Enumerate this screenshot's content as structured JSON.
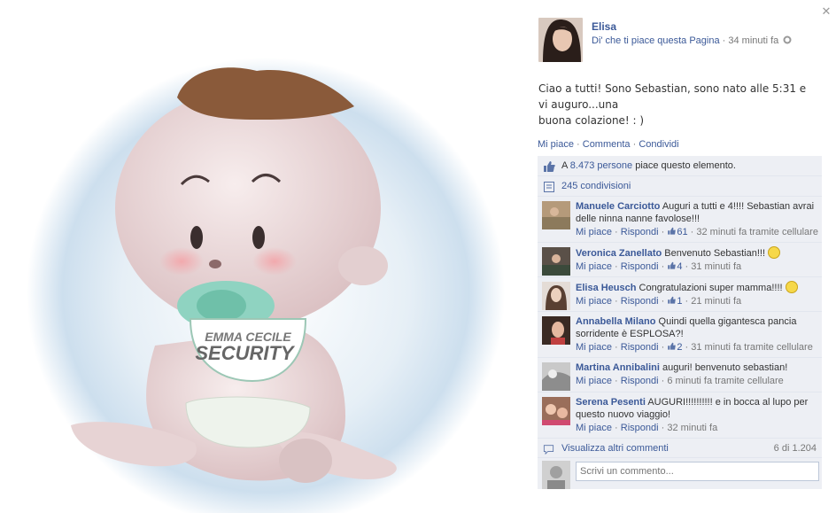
{
  "photo": {
    "bib_line1": "EMMA CECILE",
    "bib_line2": "SECURITY"
  },
  "post": {
    "close_glyph": "✕",
    "author_name": "Elisa",
    "like_page_link": "Di' che ti piace questa Pagina",
    "separator": " · ",
    "time": "34 minuti fa",
    "globe_icon": "globe-icon",
    "text_line1": "Ciao a tutti! Sono Sebastian, sono nato alle 5:31 e vi auguro...una",
    "text_line2": "buona colazione! : )",
    "actions": {
      "like": "Mi piace",
      "comment": "Commenta",
      "share": "Condividi"
    }
  },
  "ufi": {
    "likes_prefix": "A ",
    "likes_link": "8.473 persone",
    "likes_suffix": " piace questo elemento.",
    "shares": "245 condivisioni",
    "reply_label": "Mi piace",
    "reply_action": "Rispondi",
    "comments": [
      {
        "name": "Manuele Carciotto",
        "text": "Auguri a tutti e 4!!!! Sebastian avrai delle ninna nanne favolose!!!",
        "likes": "61",
        "time": "32 minuti fa tramite cellulare"
      },
      {
        "name": "Veronica Zanellato",
        "text": "Benvenuto Sebastian!!!",
        "likes": "4",
        "time": "31 minuti fa"
      },
      {
        "name": "Elisa Heusch",
        "text": "Congratulazioni super mamma!!!!",
        "likes": "1",
        "time": "21 minuti fa"
      },
      {
        "name": "Annabella Milano",
        "text": "Quindi quella gigantesca pancia sorridente è ESPLOSA?!",
        "likes": "2",
        "time": "31 minuti fa tramite cellulare"
      },
      {
        "name": "Martina Annibalini",
        "text": "auguri! benvenuto sebastian!",
        "likes": "",
        "time": "6 minuti fa tramite cellulare"
      },
      {
        "name": "Serena Pesenti",
        "text": "AUGURI!!!!!!!!!! e in bocca al lupo per questo nuovo viaggio!",
        "likes": "",
        "time": "32 minuti fa"
      }
    ],
    "view_more": "Visualizza altri commenti",
    "count": "6 di 1.204",
    "write_placeholder": "Scrivi un commento..."
  },
  "colors": {
    "link": "#3b5998",
    "ufi_bg": "#edeff4"
  }
}
